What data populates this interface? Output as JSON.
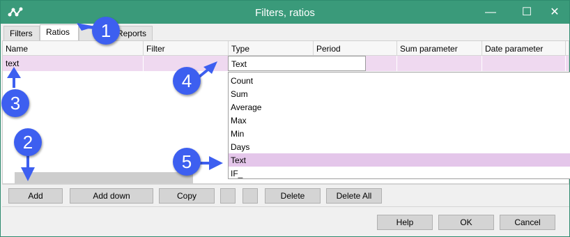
{
  "window": {
    "title": "Filters, ratios"
  },
  "tabs": [
    {
      "label": "Filters"
    },
    {
      "label": "Ratios"
    },
    {
      "label": "Reports"
    }
  ],
  "grid": {
    "columns": [
      "Name",
      "Filter",
      "Type",
      "Period",
      "Sum parameter",
      "Date parameter"
    ],
    "rows": [
      {
        "name": "text",
        "filter": "",
        "type": "Text",
        "period": "",
        "sum_parameter": "",
        "date_parameter": ""
      }
    ]
  },
  "type_combo": {
    "value": "Text",
    "options": [
      "Count",
      "Sum",
      "Average",
      "Max",
      "Min",
      "Days",
      "Text",
      "IF_"
    ],
    "selected": "Text"
  },
  "toolbar": {
    "add": "Add",
    "add_down": "Add down",
    "copy": "Copy",
    "delete": "Delete",
    "delete_all": "Delete All"
  },
  "footer": {
    "help": "Help",
    "ok": "OK",
    "cancel": "Cancel"
  },
  "callouts": [
    "1",
    "2",
    "3",
    "4",
    "5"
  ],
  "colors": {
    "titlebar": "#3a9a7a",
    "row_highlight": "#efd9f0",
    "selected_option": "#e4c6ea",
    "callout": "#3d5ff0"
  },
  "icons": [
    "app-icon",
    "minimize-icon",
    "maximize-icon",
    "close-icon"
  ]
}
